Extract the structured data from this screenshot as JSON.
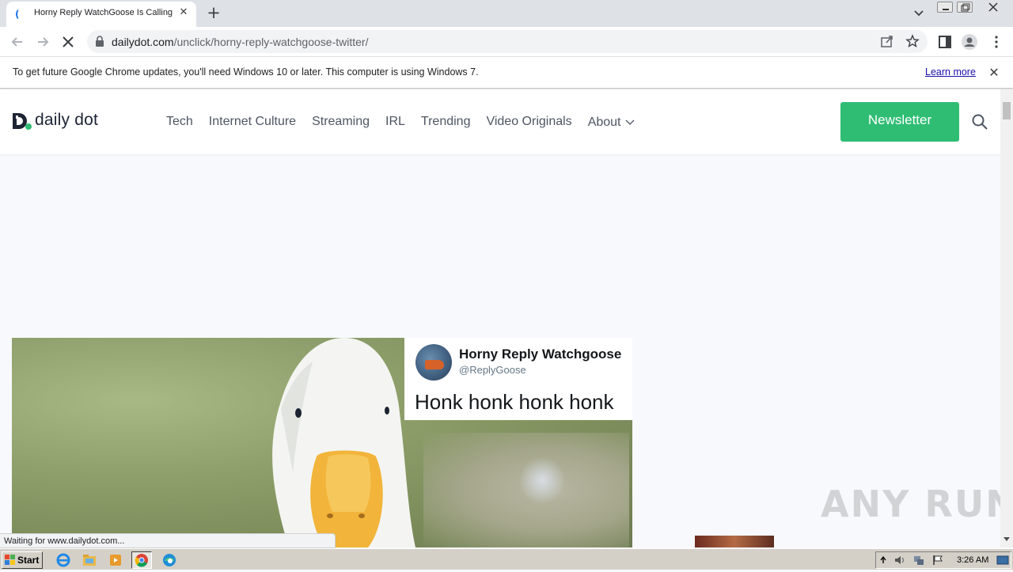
{
  "browser": {
    "tab": {
      "title": "Horny Reply WatchGoose Is Calling",
      "favicon": "("
    },
    "url": {
      "host": "dailydot.com",
      "path": "/unclick/horny-reply-watchgoose-twitter/"
    },
    "infobar": {
      "message": "To get future Google Chrome updates, you'll need Windows 10 or later. This computer is using Windows 7.",
      "link": "Learn more"
    },
    "status": "Waiting for www.dailydot.com..."
  },
  "site": {
    "logo_text": "daily dot",
    "nav": [
      "Tech",
      "Internet Culture",
      "Streaming",
      "IRL",
      "Trending",
      "Video Originals",
      "About"
    ],
    "newsletter_label": "Newsletter",
    "brand_color": "#2fbd74"
  },
  "article": {
    "tweet": {
      "name": "Horny Reply Watchgoose",
      "handle": "@ReplyGoose",
      "text": "Honk honk honk honk"
    }
  },
  "watermark": "ANY RUN",
  "taskbar": {
    "start_label": "Start",
    "apps": [
      "ie-icon",
      "explorer-icon",
      "media-player-icon",
      "chrome-icon",
      "edge-icon"
    ],
    "time": "3:26 AM"
  }
}
